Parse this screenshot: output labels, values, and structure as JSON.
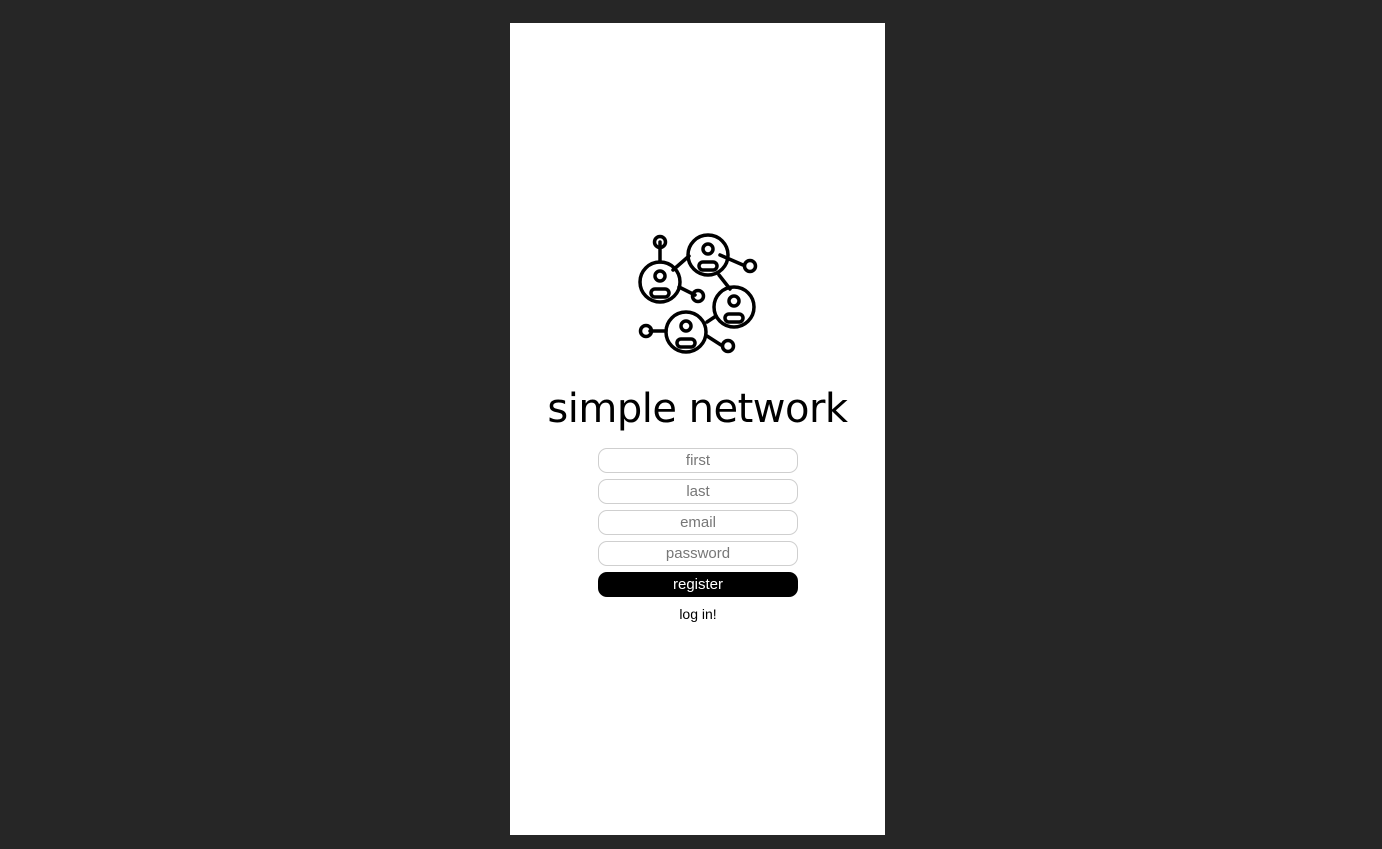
{
  "app": {
    "title": "simple network",
    "logo_icon": "network-people-icon"
  },
  "register_form": {
    "first_placeholder": "first",
    "last_placeholder": "last",
    "email_placeholder": "email",
    "password_placeholder": "password",
    "register_label": "register",
    "login_link_label": "log in!"
  },
  "colors": {
    "page_background": "#262626",
    "card_background": "#ffffff",
    "button_background": "#000000",
    "button_text": "#ffffff"
  }
}
